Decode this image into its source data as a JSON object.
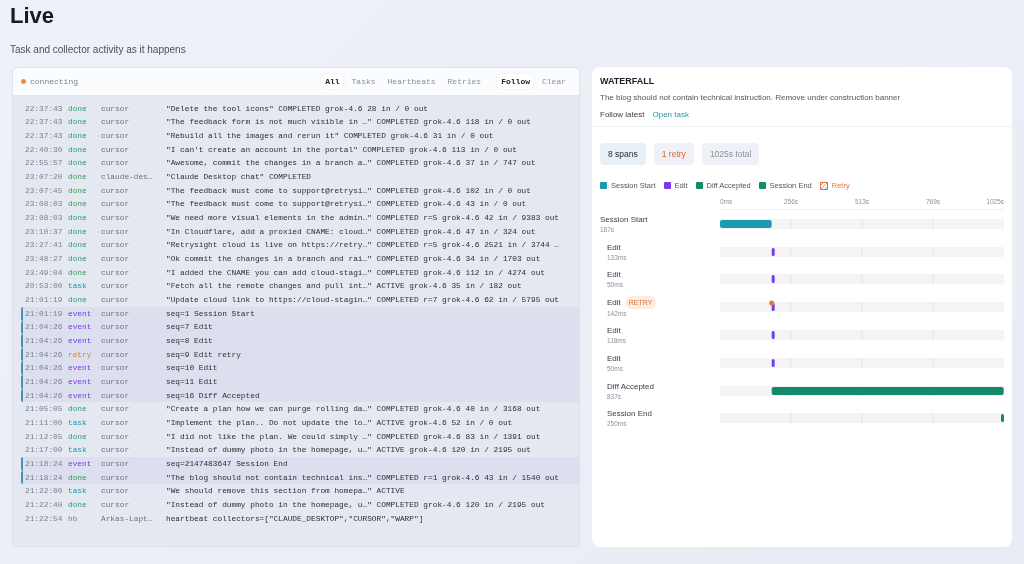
{
  "page": {
    "title": "Live",
    "subtitle": "Task and collector activity as it happens"
  },
  "log": {
    "status": {
      "label": "connecting",
      "color": "#e8914a"
    },
    "filters": [
      {
        "label": "All",
        "selected": true
      },
      {
        "label": "Tasks",
        "selected": false
      },
      {
        "label": "Heartbeats",
        "selected": false
      },
      {
        "label": "Retries",
        "selected": false
      }
    ],
    "follow": {
      "label": "Follow",
      "on": true
    },
    "clear": "Clear",
    "rows": [
      {
        "time": "22:37:43",
        "type": "done",
        "kind": "done",
        "source": "cursor",
        "message": "\"Delete the tool icons\" COMPLETED grok-4.6 28 in / 0 out",
        "highlighted": false
      },
      {
        "time": "22:37:43",
        "type": "done",
        "kind": "done",
        "source": "cursor",
        "message": "\"The feedback form is not much visible in …\" COMPLETED grok-4.6 118 in / 0 out",
        "highlighted": false
      },
      {
        "time": "22:37:43",
        "type": "done",
        "kind": "done",
        "source": "cursor",
        "message": "\"Rebuild all the images and rerun it\" COMPLETED grok-4.6 31 in / 0 out",
        "highlighted": false
      },
      {
        "time": "22:40:30",
        "type": "done",
        "kind": "done",
        "source": "cursor",
        "message": "\"I can't create an account in the portal\" COMPLETED grok-4.6 113 in / 0 out",
        "highlighted": false
      },
      {
        "time": "22:55:57",
        "type": "done",
        "kind": "done",
        "source": "cursor",
        "message": "\"Awesome, commit the changes in a branch a…\" COMPLETED grok-4.6 37 in / 747 out",
        "highlighted": false
      },
      {
        "time": "23:07:20",
        "type": "done",
        "kind": "done",
        "source": "claude-des…",
        "message": "\"Claude Desktop chat\" COMPLETED",
        "highlighted": false
      },
      {
        "time": "23:07:45",
        "type": "done",
        "kind": "done",
        "source": "cursor",
        "message": "\"The feedback must come to support@retrysi…\" COMPLETED grok-4.6 102 in / 0 out",
        "highlighted": false
      },
      {
        "time": "23:08:03",
        "type": "done",
        "kind": "done",
        "source": "cursor",
        "message": "\"The feedback must come to support@retrysi…\" COMPLETED grok-4.6 43 in / 0 out",
        "highlighted": false
      },
      {
        "time": "23:08:03",
        "type": "done",
        "kind": "done",
        "source": "cursor",
        "message": "\"We need more visual elements in the admin…\" COMPLETED r=5 grok-4.6 42 in / 9383 out",
        "highlighted": false
      },
      {
        "time": "23:10:37",
        "type": "done",
        "kind": "done",
        "source": "cursor",
        "message": "\"In Cloudflare, add a proxied CNAME: cloud…\" COMPLETED grok-4.6 47 in / 324 out",
        "highlighted": false
      },
      {
        "time": "23:27:41",
        "type": "done",
        "kind": "done",
        "source": "cursor",
        "message": "\"Retrysight cloud is live on https://retry…\" COMPLETED r=5 grok-4.6 2521 in / 3744 …",
        "highlighted": false
      },
      {
        "time": "23:48:27",
        "type": "done",
        "kind": "done",
        "source": "cursor",
        "message": "\"Ok commit the changes in a branch and rai…\" COMPLETED grok-4.6 34 in / 1703 out",
        "highlighted": false
      },
      {
        "time": "23:49:04",
        "type": "done",
        "kind": "done",
        "source": "cursor",
        "message": "\"I added the CNAME you can add cloud-stagi…\" COMPLETED grok-4.6 112 in / 4274 out",
        "highlighted": false
      },
      {
        "time": "20:53:00",
        "type": "task",
        "kind": "task",
        "source": "cursor",
        "message": "\"Fetch all the remote changes and pull int…\" ACTIVE grok-4.6 35 in / 182 out",
        "highlighted": false
      },
      {
        "time": "21:01:19",
        "type": "done",
        "kind": "done",
        "source": "cursor",
        "message": "\"Update cloud link to https://cloud-stagin…\" COMPLETED r=7 grok-4.6 62 in / 5795 out",
        "highlighted": false
      },
      {
        "time": "21:01:19",
        "type": "event",
        "kind": "event",
        "source": "cursor",
        "message": "seq=1 Session Start",
        "highlighted": true
      },
      {
        "time": "21:04:26",
        "type": "event",
        "kind": "event",
        "source": "cursor",
        "message": "seq=7 Edit",
        "highlighted": true
      },
      {
        "time": "21:04:26",
        "type": "event",
        "kind": "event",
        "source": "cursor",
        "message": "seq=8 Edit",
        "highlighted": true
      },
      {
        "time": "21:04:26",
        "type": "retry",
        "kind": "retry",
        "source": "cursor",
        "message": "seq=9 Edit retry",
        "highlighted": true
      },
      {
        "time": "21:04:26",
        "type": "event",
        "kind": "event",
        "source": "cursor",
        "message": "seq=10 Edit",
        "highlighted": true
      },
      {
        "time": "21:04:26",
        "type": "event",
        "kind": "event",
        "source": "cursor",
        "message": "seq=11 Edit",
        "highlighted": true
      },
      {
        "time": "21:04:26",
        "type": "event",
        "kind": "event",
        "source": "cursor",
        "message": "seq=16 Diff Accepted",
        "highlighted": true
      },
      {
        "time": "21:05:05",
        "type": "done",
        "kind": "done",
        "source": "cursor",
        "message": "\"Create a plan how we can purge rolling da…\" COMPLETED grok-4.6 40 in / 3168 out",
        "highlighted": false
      },
      {
        "time": "21:11:00",
        "type": "task",
        "kind": "task",
        "source": "cursor",
        "message": "\"Implement the plan.. Do not update the lo…\" ACTIVE grok-4.6 52 in / 0 out",
        "highlighted": false
      },
      {
        "time": "21:12:05",
        "type": "done",
        "kind": "done",
        "source": "cursor",
        "message": "\"I did not like the plan. We could simply …\" COMPLETED grok-4.6 83 in / 1391 out",
        "highlighted": false
      },
      {
        "time": "21:17:00",
        "type": "task",
        "kind": "task",
        "source": "cursor",
        "message": "\"Instead of dummy photo in the homepage, u…\" ACTIVE grok-4.6 120 in / 2195 out",
        "highlighted": false
      },
      {
        "time": "21:18:24",
        "type": "event",
        "kind": "event",
        "source": "cursor",
        "message": "seq=2147483647 Session End",
        "highlighted": true
      },
      {
        "time": "21:18:24",
        "type": "done",
        "kind": "done",
        "source": "cursor",
        "message": "\"The blog should not contain technical ins…\" COMPLETED r=1 grok-4.6 43 in / 1540 out",
        "highlighted": true
      },
      {
        "time": "21:22:00",
        "type": "task",
        "kind": "task",
        "source": "cursor",
        "message": "\"We should remove this section from homepa…\" ACTIVE",
        "highlighted": false
      },
      {
        "time": "21:22:40",
        "type": "done",
        "kind": "done",
        "source": "cursor",
        "message": "\"Instead of dummy photo in the homepage, u…\" COMPLETED grok-4.6 120 in / 2195 out",
        "highlighted": false
      },
      {
        "time": "21:22:54",
        "type": "hb",
        "kind": "hb",
        "source": "Arkas-Lapt…",
        "message": "heartbeat collectors=[\"CLAUDE_DESKTOP\",\"CURSOR\",\"WARP\"]",
        "highlighted": false
      }
    ]
  },
  "waterfall": {
    "title": "WATERFALL",
    "description": "The blog should not contain technical instruction. Remove under construction banner",
    "follow_latest": "Follow latest",
    "open_task": "Open task",
    "chips": [
      {
        "label": "8 spans",
        "kind": "neutral"
      },
      {
        "label": "1 retry",
        "kind": "retry"
      },
      {
        "label": "1025s total",
        "kind": "muted"
      }
    ],
    "legend": [
      {
        "label": "Session Start",
        "color": "#1a9bb0",
        "kind": "solid"
      },
      {
        "label": "Edit",
        "color": "#7c3aed",
        "kind": "solid"
      },
      {
        "label": "Diff Accepted",
        "color": "#138a6a",
        "kind": "solid"
      },
      {
        "label": "Session End",
        "color": "#0f8f62",
        "kind": "solid"
      },
      {
        "label": "Retry",
        "color": "#e8743c",
        "kind": "hatch"
      }
    ],
    "axis_ticks": [
      "0ms",
      "256s",
      "513s",
      "769s",
      "1025s"
    ],
    "spans": [
      {
        "label": "Session Start",
        "duration": "187s",
        "color": "#1a9bb0",
        "kind": "bar",
        "level": 0.182,
        "children": [
          {
            "label": "Edit",
            "duration": "133ms",
            "color": "#7c3aed",
            "kind": "point"
          },
          {
            "label": "Edit",
            "duration": "50ms",
            "color": "#7c3aed",
            "kind": "point"
          },
          {
            "label": "Edit",
            "duration": "142ms",
            "color": "#7c3aed",
            "kind": "point",
            "badge": "RETRY"
          },
          {
            "label": "Edit",
            "duration": "118ms",
            "color": "#7c3aed",
            "kind": "point"
          },
          {
            "label": "Edit",
            "duration": "50ms",
            "color": "#7c3aed",
            "kind": "point"
          },
          {
            "label": "Diff Accepted",
            "duration": "837s",
            "color": "#138a6a",
            "kind": "bar",
            "level": 0.817
          },
          {
            "label": "Session End",
            "duration": "250ms",
            "color": "#0f8f62",
            "kind": "point"
          }
        ]
      }
    ]
  }
}
